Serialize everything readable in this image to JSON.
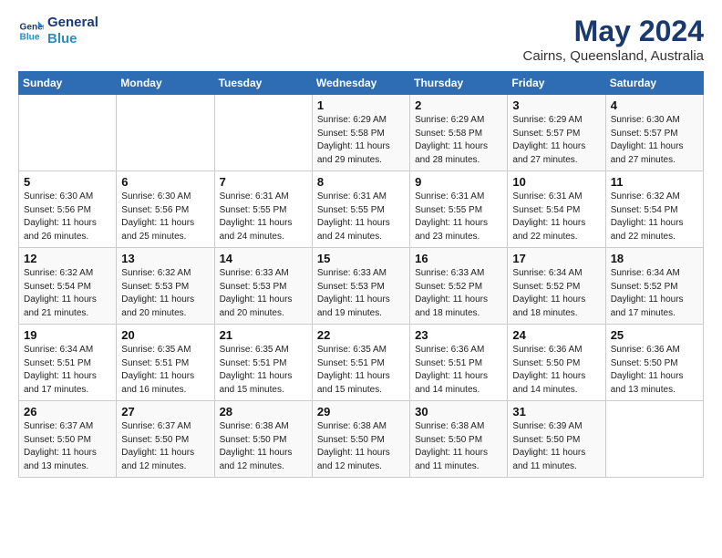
{
  "header": {
    "logo_line1": "General",
    "logo_line2": "Blue",
    "month": "May 2024",
    "location": "Cairns, Queensland, Australia"
  },
  "weekdays": [
    "Sunday",
    "Monday",
    "Tuesday",
    "Wednesday",
    "Thursday",
    "Friday",
    "Saturday"
  ],
  "weeks": [
    [
      {
        "day": "",
        "info": ""
      },
      {
        "day": "",
        "info": ""
      },
      {
        "day": "",
        "info": ""
      },
      {
        "day": "1",
        "info": "Sunrise: 6:29 AM\nSunset: 5:58 PM\nDaylight: 11 hours\nand 29 minutes."
      },
      {
        "day": "2",
        "info": "Sunrise: 6:29 AM\nSunset: 5:58 PM\nDaylight: 11 hours\nand 28 minutes."
      },
      {
        "day": "3",
        "info": "Sunrise: 6:29 AM\nSunset: 5:57 PM\nDaylight: 11 hours\nand 27 minutes."
      },
      {
        "day": "4",
        "info": "Sunrise: 6:30 AM\nSunset: 5:57 PM\nDaylight: 11 hours\nand 27 minutes."
      }
    ],
    [
      {
        "day": "5",
        "info": "Sunrise: 6:30 AM\nSunset: 5:56 PM\nDaylight: 11 hours\nand 26 minutes."
      },
      {
        "day": "6",
        "info": "Sunrise: 6:30 AM\nSunset: 5:56 PM\nDaylight: 11 hours\nand 25 minutes."
      },
      {
        "day": "7",
        "info": "Sunrise: 6:31 AM\nSunset: 5:55 PM\nDaylight: 11 hours\nand 24 minutes."
      },
      {
        "day": "8",
        "info": "Sunrise: 6:31 AM\nSunset: 5:55 PM\nDaylight: 11 hours\nand 24 minutes."
      },
      {
        "day": "9",
        "info": "Sunrise: 6:31 AM\nSunset: 5:55 PM\nDaylight: 11 hours\nand 23 minutes."
      },
      {
        "day": "10",
        "info": "Sunrise: 6:31 AM\nSunset: 5:54 PM\nDaylight: 11 hours\nand 22 minutes."
      },
      {
        "day": "11",
        "info": "Sunrise: 6:32 AM\nSunset: 5:54 PM\nDaylight: 11 hours\nand 22 minutes."
      }
    ],
    [
      {
        "day": "12",
        "info": "Sunrise: 6:32 AM\nSunset: 5:54 PM\nDaylight: 11 hours\nand 21 minutes."
      },
      {
        "day": "13",
        "info": "Sunrise: 6:32 AM\nSunset: 5:53 PM\nDaylight: 11 hours\nand 20 minutes."
      },
      {
        "day": "14",
        "info": "Sunrise: 6:33 AM\nSunset: 5:53 PM\nDaylight: 11 hours\nand 20 minutes."
      },
      {
        "day": "15",
        "info": "Sunrise: 6:33 AM\nSunset: 5:53 PM\nDaylight: 11 hours\nand 19 minutes."
      },
      {
        "day": "16",
        "info": "Sunrise: 6:33 AM\nSunset: 5:52 PM\nDaylight: 11 hours\nand 18 minutes."
      },
      {
        "day": "17",
        "info": "Sunrise: 6:34 AM\nSunset: 5:52 PM\nDaylight: 11 hours\nand 18 minutes."
      },
      {
        "day": "18",
        "info": "Sunrise: 6:34 AM\nSunset: 5:52 PM\nDaylight: 11 hours\nand 17 minutes."
      }
    ],
    [
      {
        "day": "19",
        "info": "Sunrise: 6:34 AM\nSunset: 5:51 PM\nDaylight: 11 hours\nand 17 minutes."
      },
      {
        "day": "20",
        "info": "Sunrise: 6:35 AM\nSunset: 5:51 PM\nDaylight: 11 hours\nand 16 minutes."
      },
      {
        "day": "21",
        "info": "Sunrise: 6:35 AM\nSunset: 5:51 PM\nDaylight: 11 hours\nand 15 minutes."
      },
      {
        "day": "22",
        "info": "Sunrise: 6:35 AM\nSunset: 5:51 PM\nDaylight: 11 hours\nand 15 minutes."
      },
      {
        "day": "23",
        "info": "Sunrise: 6:36 AM\nSunset: 5:51 PM\nDaylight: 11 hours\nand 14 minutes."
      },
      {
        "day": "24",
        "info": "Sunrise: 6:36 AM\nSunset: 5:50 PM\nDaylight: 11 hours\nand 14 minutes."
      },
      {
        "day": "25",
        "info": "Sunrise: 6:36 AM\nSunset: 5:50 PM\nDaylight: 11 hours\nand 13 minutes."
      }
    ],
    [
      {
        "day": "26",
        "info": "Sunrise: 6:37 AM\nSunset: 5:50 PM\nDaylight: 11 hours\nand 13 minutes."
      },
      {
        "day": "27",
        "info": "Sunrise: 6:37 AM\nSunset: 5:50 PM\nDaylight: 11 hours\nand 12 minutes."
      },
      {
        "day": "28",
        "info": "Sunrise: 6:38 AM\nSunset: 5:50 PM\nDaylight: 11 hours\nand 12 minutes."
      },
      {
        "day": "29",
        "info": "Sunrise: 6:38 AM\nSunset: 5:50 PM\nDaylight: 11 hours\nand 12 minutes."
      },
      {
        "day": "30",
        "info": "Sunrise: 6:38 AM\nSunset: 5:50 PM\nDaylight: 11 hours\nand 11 minutes."
      },
      {
        "day": "31",
        "info": "Sunrise: 6:39 AM\nSunset: 5:50 PM\nDaylight: 11 hours\nand 11 minutes."
      },
      {
        "day": "",
        "info": ""
      }
    ]
  ]
}
